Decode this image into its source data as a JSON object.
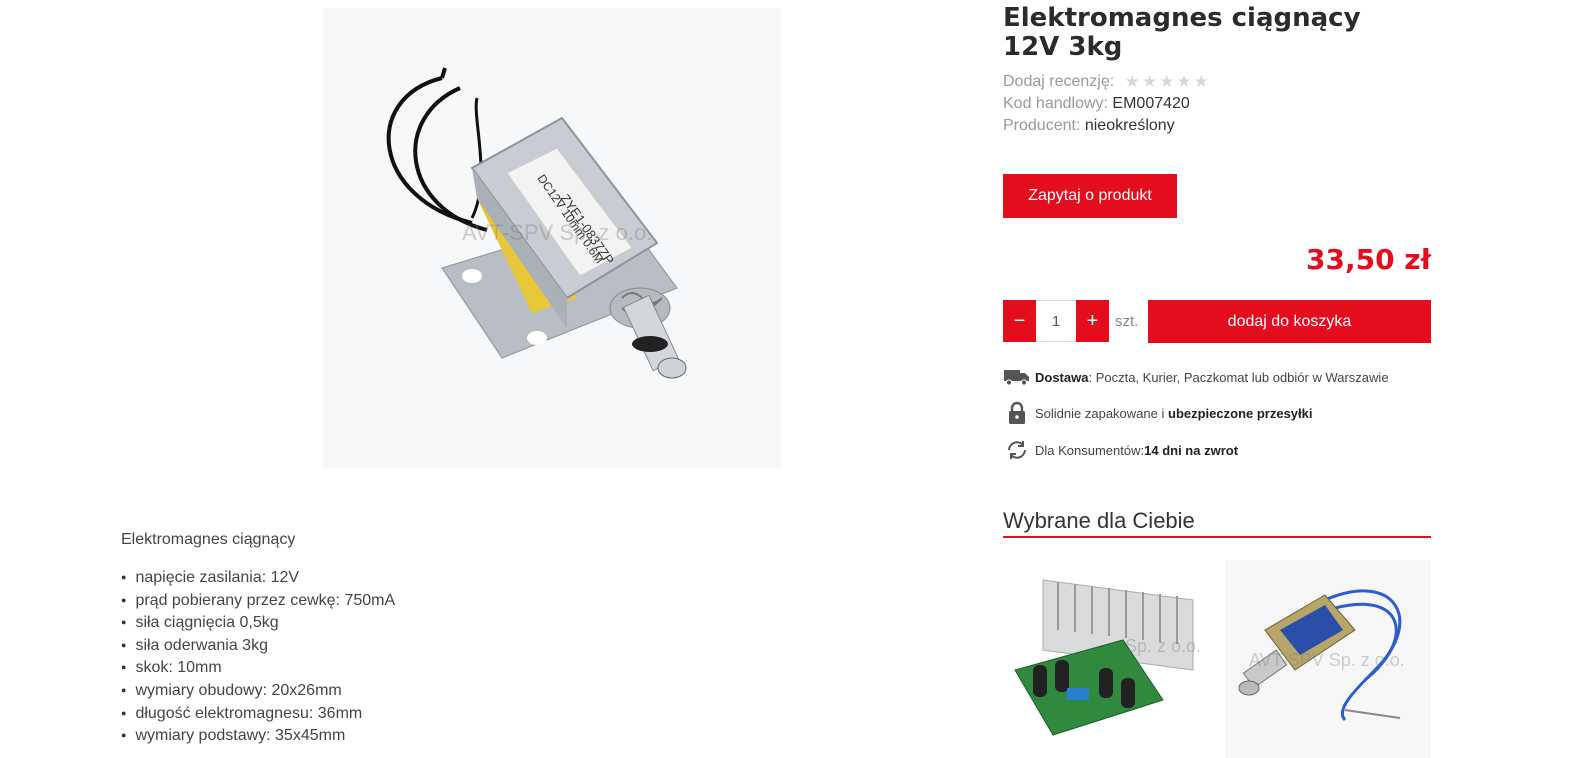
{
  "product": {
    "title": "Elektromagnes ciągnący 12V 3kg",
    "review_label": "Dodaj recenzję:",
    "rating": 0,
    "rating_max": 5,
    "code_label": "Kod handlowy:",
    "code_value": "EM007420",
    "producer_label": "Producent:",
    "producer_value": "nieokreślony",
    "ask_button": "Zapytaj o produkt",
    "price": "33,50 zł",
    "quantity": "1",
    "unit": "szt.",
    "cart_button": "dodaj do koszyka",
    "image_watermark": "AVT-SPV Sp. z o.o.",
    "label_line1": "ZYE1-0837ZP",
    "label_line2": "DC12V 10mm 0.6M"
  },
  "info": {
    "delivery_bold": "Dostawa",
    "delivery_text": ": Poczta, Kurier, Paczkomat lub odbiór w Warszawie",
    "pack_text": "Solidnie zapakowane i ",
    "pack_bold": "ubezpieczone przesyłki",
    "return_text": "Dla Konsumentów: ",
    "return_bold": "14 dni na zwrot"
  },
  "recommended": {
    "title": "Wybrane dla Ciebie",
    "watermark1": "Sp. z o.o.",
    "watermark2": "AVT-SPV Sp. z o.o."
  },
  "description": {
    "title": "Elektromagnes ciągnący",
    "specs": [
      "napięcie zasilania: 12V",
      "prąd pobierany przez cewkę: 750mA",
      "siła ciągnięcia 0,5kg",
      "siła oderwania 3kg",
      "skok: 10mm",
      "wymiary obudowy: 20x26mm",
      "długość elektromagnesu: 36mm",
      "wymiary podstawy: 35x45mm"
    ]
  },
  "colors": {
    "accent": "#e30d1e"
  },
  "icons": [
    "truck-icon",
    "lock-icon",
    "refresh-icon",
    "minus-icon",
    "plus-icon",
    "star-icon"
  ]
}
